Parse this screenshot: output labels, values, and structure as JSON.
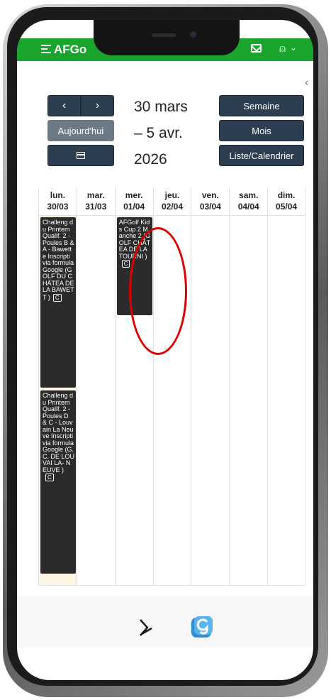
{
  "app": {
    "title": "AFGo"
  },
  "toolbar": {
    "prev_label": "‹",
    "next_label": "›",
    "today_label": "Aujourd'hui",
    "title_line1": "30 mars",
    "title_line2": "– 5 avr.",
    "title_line3": "2026",
    "week_label": "Semaine",
    "month_label": "Mois",
    "list_label": "Liste/Calendrier"
  },
  "days": [
    {
      "name": "lun.",
      "date": "30/03"
    },
    {
      "name": "mar.",
      "date": "31/03"
    },
    {
      "name": "mer.",
      "date": "01/04"
    },
    {
      "name": "jeu.",
      "date": "02/04"
    },
    {
      "name": "ven.",
      "date": "03/04"
    },
    {
      "name": "sam.",
      "date": "04/04"
    },
    {
      "name": "dim.",
      "date": "05/04"
    }
  ],
  "events": [
    {
      "day": 0,
      "text": "Challeng du Printem Qualif. 2 - Poules B & A - Bawette Inscripti via formula Google (GOLF DU CHÂTEA DE LA BAWETT )",
      "badge": "C"
    },
    {
      "day": 0,
      "text": "Challeng du Printem Qualif. 2 - Poules D & C - Louvain La Neuve Inscripti via formula Google (G. C. DE LOUVAI LA- NEUVE )",
      "badge": "C"
    },
    {
      "day": 2,
      "text": "AFGolf Kids Cup 2 Manche 2 (GOLF CHÂTEA DE LA TOURNI )",
      "badge": "C"
    }
  ],
  "icons": {
    "menu": "hamburger-icon",
    "mail": "mail-icon",
    "user": "user-icon",
    "calendar": "calendar-icon"
  },
  "colors": {
    "appbar": "#1aa52e",
    "button": "#2c3e50",
    "event": "#2b2b2b",
    "today_bg": "#fdf6e3",
    "annotation": "#e00000"
  }
}
